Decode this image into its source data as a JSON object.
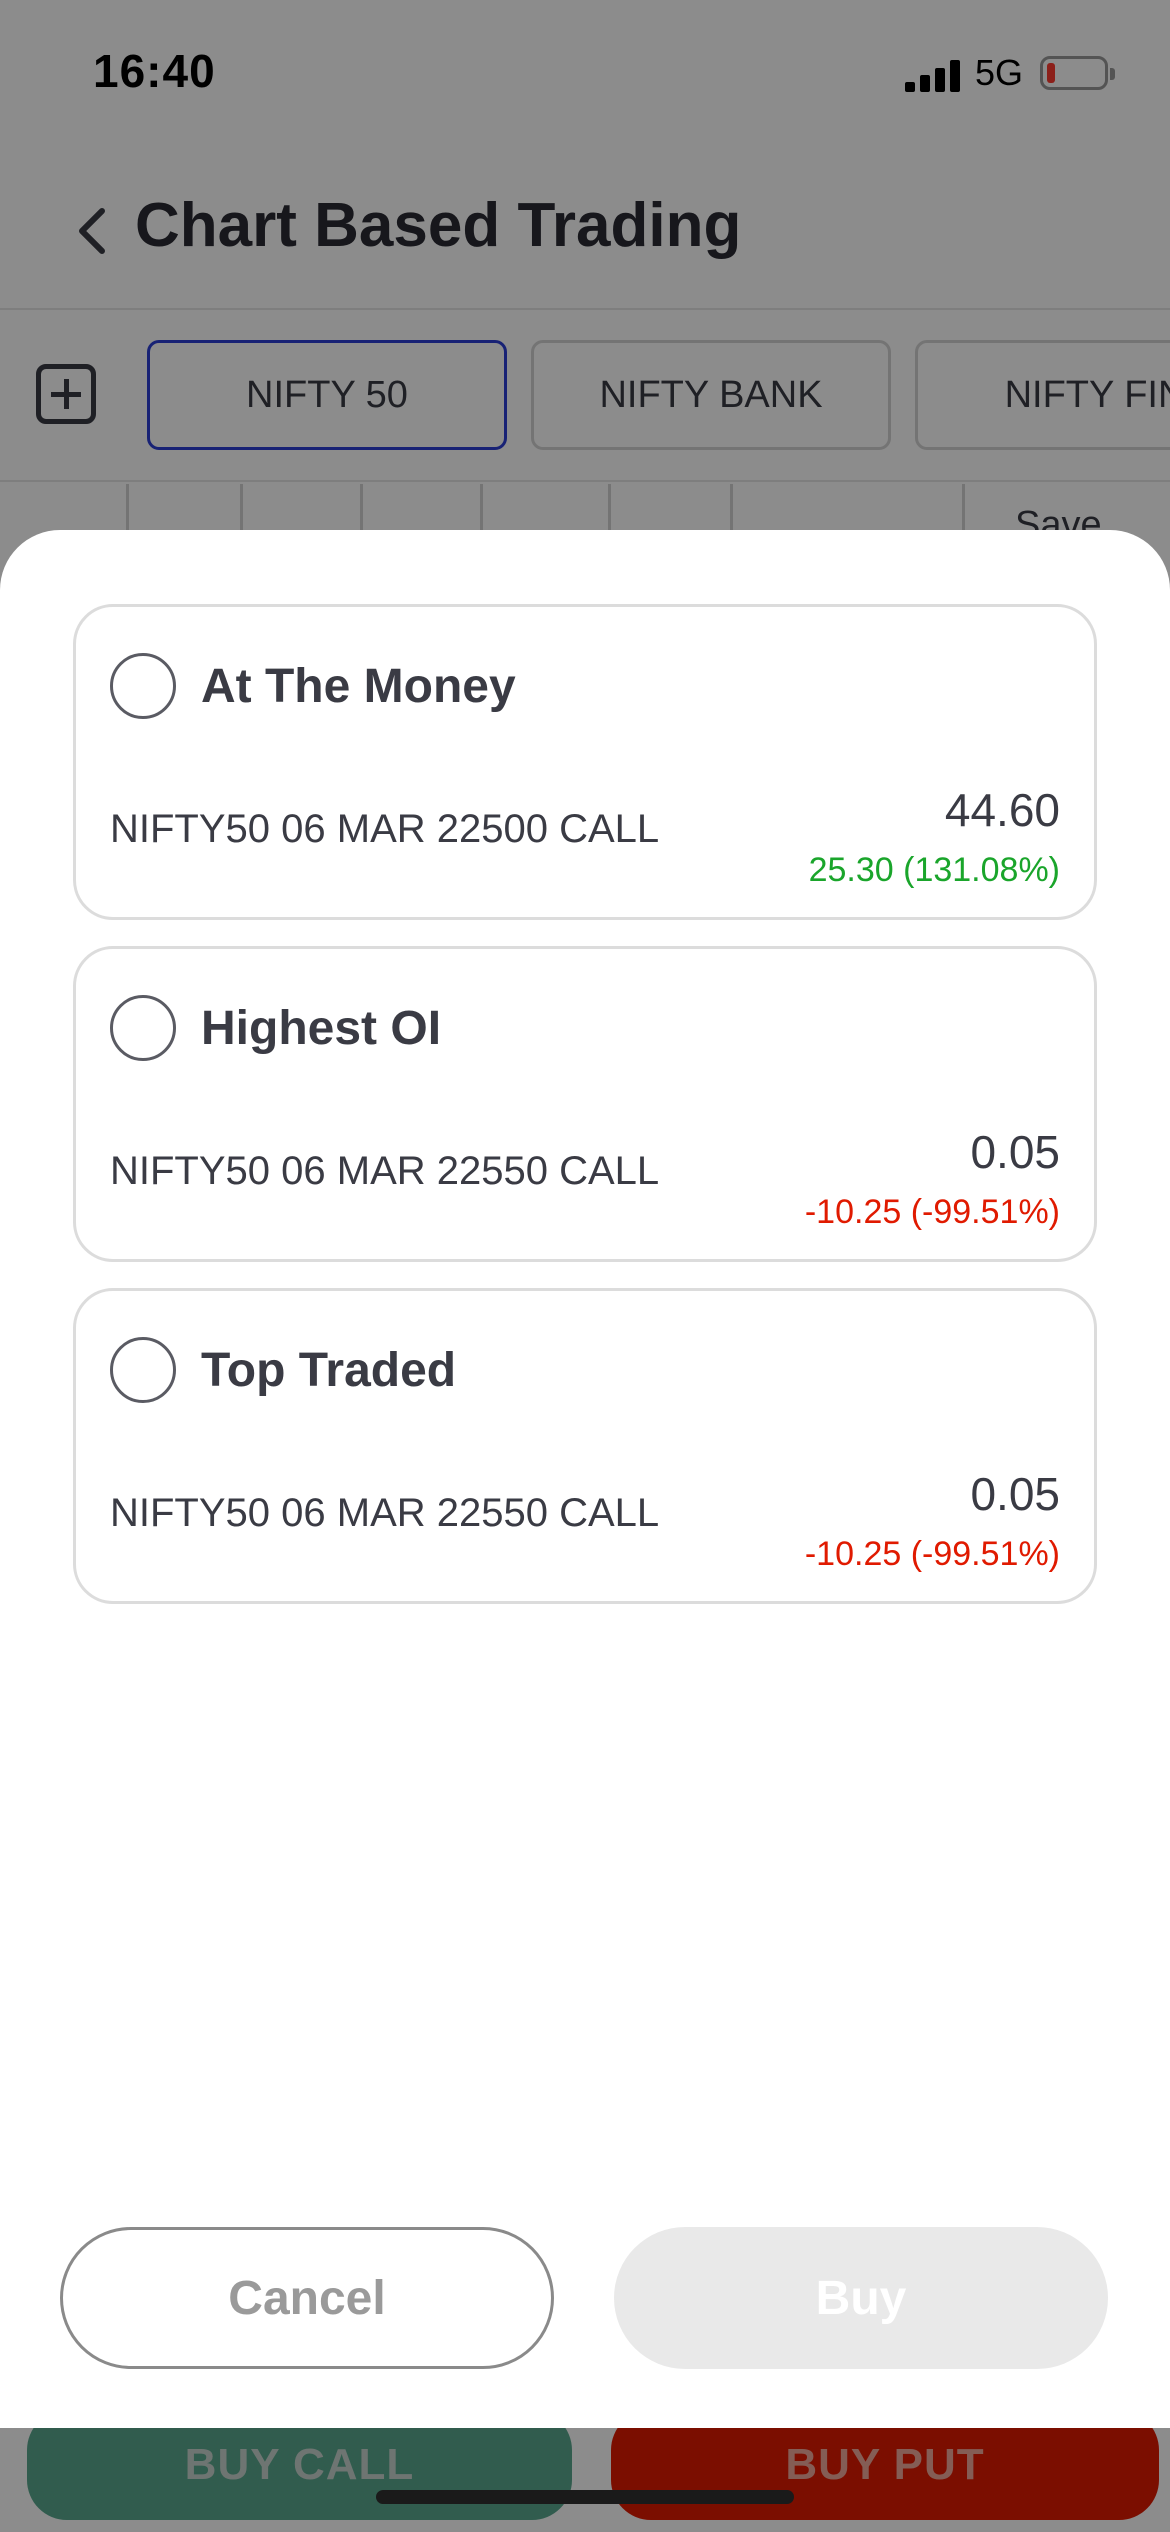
{
  "status_bar": {
    "time": "16:40",
    "network": "5G",
    "battery_level_fraction": 0.15,
    "battery_color": "#ff3b30"
  },
  "header": {
    "title": "Chart Based Trading",
    "back_icon": "chevron-left-icon"
  },
  "index_tabs": [
    {
      "label": "NIFTY 50",
      "active": true
    },
    {
      "label": "NIFTY BANK",
      "active": false
    },
    {
      "label": "NIFTY FIN",
      "active": false
    }
  ],
  "toolbar": {
    "save_label": "Save"
  },
  "sheet": {
    "options": [
      {
        "title": "At The Money",
        "contract": "NIFTY50 06 MAR 22500 CALL",
        "price": "44.60",
        "change": "25.30 (131.08%)",
        "direction": "up"
      },
      {
        "title": "Highest OI",
        "contract": "NIFTY50 06 MAR 22550 CALL",
        "price": "0.05",
        "change": "-10.25 (-99.51%)",
        "direction": "down"
      },
      {
        "title": "Top Traded",
        "contract": "NIFTY50 06 MAR 22550 CALL",
        "price": "0.05",
        "change": "-10.25 (-99.51%)",
        "direction": "down"
      }
    ],
    "cancel_label": "Cancel",
    "buy_label": "Buy"
  },
  "bottom_actions": {
    "buy_call_label": "BUY CALL",
    "buy_put_label": "BUY PUT"
  },
  "colors": {
    "active_tab_border": "#2d3fd6",
    "positive": "#1aa52b",
    "negative": "#e01a00",
    "buy_call_bg": "#59a88f",
    "buy_put_bg": "#e01a00"
  }
}
